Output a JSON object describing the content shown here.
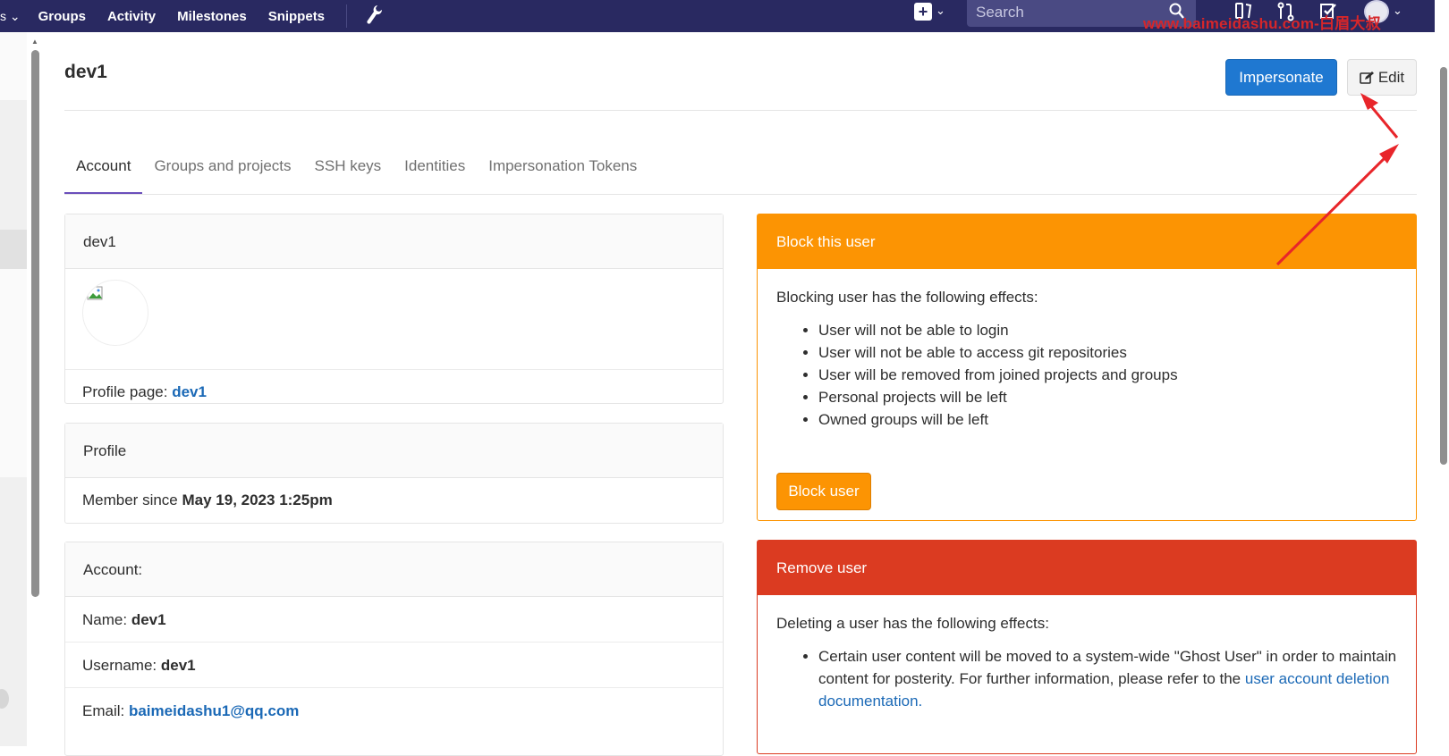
{
  "topnav": {
    "items": [
      "Groups",
      "Activity",
      "Milestones",
      "Snippets"
    ],
    "search_placeholder": "Search",
    "watermark": "www.baimeidashu.com-白眉大叔",
    "colors": {
      "background": "#292961",
      "search_bg": "#4a4a83"
    }
  },
  "page": {
    "title": "dev1",
    "impersonate_label": "Impersonate",
    "edit_label": "Edit"
  },
  "tabs": [
    {
      "label": "Account",
      "active": true
    },
    {
      "label": "Groups and projects",
      "active": false
    },
    {
      "label": "SSH keys",
      "active": false
    },
    {
      "label": "Identities",
      "active": false
    },
    {
      "label": "Impersonation Tokens",
      "active": false
    }
  ],
  "user_panel": {
    "header": "dev1",
    "profile_page_label": "Profile page:",
    "profile_page_link": "dev1"
  },
  "profile_panel": {
    "header": "Profile",
    "member_since_label": "Member since",
    "member_since_value": "May 19, 2023 1:25pm"
  },
  "account_panel": {
    "header": "Account:",
    "name_label": "Name:",
    "name_value": "dev1",
    "username_label": "Username:",
    "username_value": "dev1",
    "email_label": "Email:",
    "email_value": "baimeidashu1@qq.com"
  },
  "block_panel": {
    "header": "Block this user",
    "intro": "Blocking user has the following effects:",
    "effects": [
      "User will not be able to login",
      "User will not be able to access git repositories",
      "User will be removed from joined projects and groups",
      "Personal projects will be left",
      "Owned groups will be left"
    ],
    "button_label": "Block user",
    "color": "#fc9403"
  },
  "remove_panel": {
    "header": "Remove user",
    "intro": "Deleting a user has the following effects:",
    "effect_text": "Certain user content will be moved to a system-wide \"Ghost User\" in order to maintain content for posterity. For further information, please refer to the",
    "effect_link": "user account deletion documentation.",
    "color": "#db3b21"
  },
  "icons": [
    "chevron-down-icon",
    "wrench-icon",
    "plus-square-icon",
    "search-icon",
    "issues-icon",
    "merge-request-icon",
    "todo-check-icon",
    "avatar-icon",
    "edit-icon",
    "broken-image-icon"
  ],
  "annotations": {
    "arrow_color": "#e8252a"
  }
}
